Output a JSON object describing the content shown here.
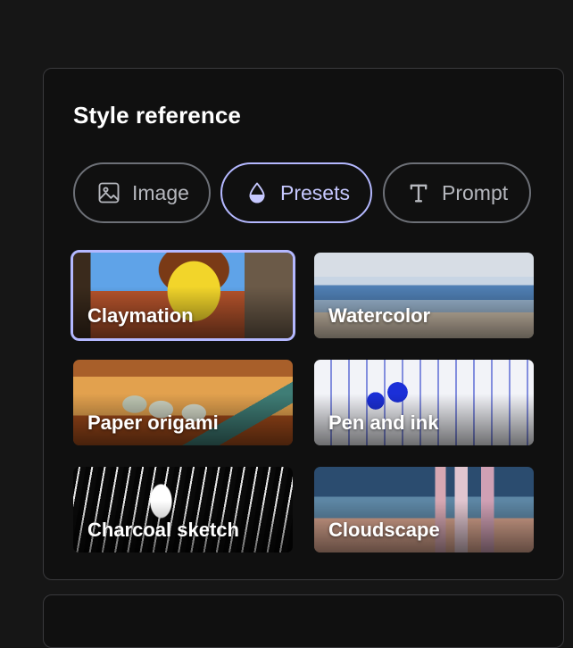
{
  "panel": {
    "title": "Style reference"
  },
  "tabs": [
    {
      "label": "Image",
      "icon": "image-icon",
      "active": false
    },
    {
      "label": "Presets",
      "icon": "droplet-icon",
      "active": true
    },
    {
      "label": "Prompt",
      "icon": "text-icon",
      "active": false
    }
  ],
  "presets": [
    {
      "label": "Claymation",
      "selected": true
    },
    {
      "label": "Watercolor",
      "selected": false
    },
    {
      "label": "Paper origami",
      "selected": false
    },
    {
      "label": "Pen and ink",
      "selected": false
    },
    {
      "label": "Charcoal sketch",
      "selected": false
    },
    {
      "label": "Cloudscape",
      "selected": false
    }
  ],
  "colors": {
    "background": "#161616",
    "panel": "#101010",
    "accent": "#b4b8ff",
    "tab_border": "#6d7077"
  }
}
